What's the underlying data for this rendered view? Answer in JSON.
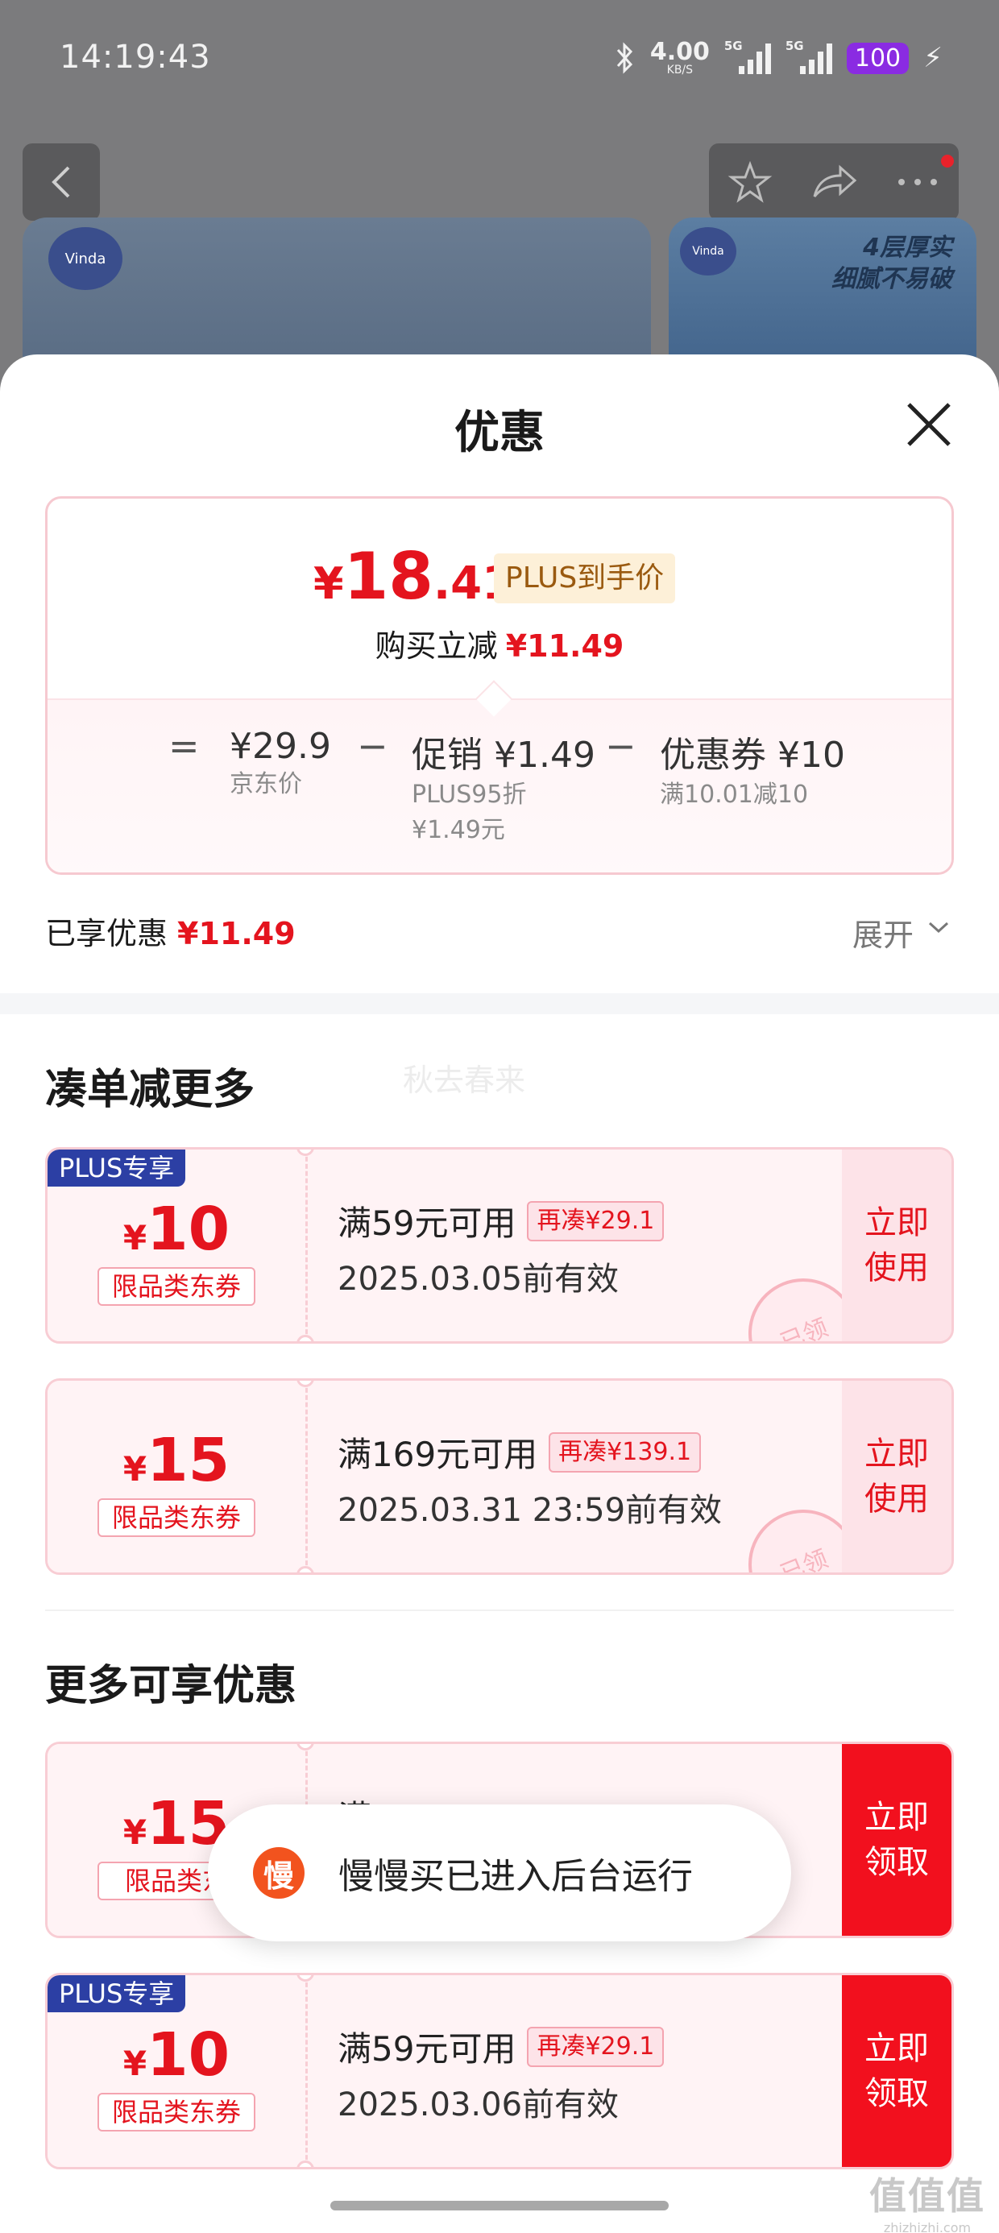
{
  "status_bar": {
    "time": "14:19:43",
    "speed_value": "4.00",
    "speed_unit": "KB/S",
    "sig1_label": "5G",
    "sig2_label": "5G",
    "battery": "100"
  },
  "background_page": {
    "brand_logo_text": "Vinda",
    "slogan_line1": "4层厚实",
    "slogan_line2": "细腻不易破"
  },
  "sheet": {
    "title": "优惠",
    "price": {
      "currency": "¥",
      "integer": "18",
      "decimal": ".41",
      "tag": "PLUS到手价",
      "reduce_label": "购买立减",
      "reduce_value": "¥11.49"
    },
    "breakdown": {
      "equals": "=",
      "jd_price": "¥29.9",
      "jd_price_label": "京东价",
      "minus1": "−",
      "promo": "促销 ¥1.49",
      "promo_detail1": "PLUS95折",
      "promo_detail2": "¥1.49元",
      "minus2": "−",
      "coupon": "优惠券 ¥10",
      "coupon_detail": "满10.01减10"
    },
    "enjoyed_label": "已享优惠",
    "enjoyed_value": "¥11.49",
    "expand_label": "展开"
  },
  "section1": {
    "title": "凑单减更多",
    "watermark": "秋去春来"
  },
  "section2": {
    "title": "更多可享优惠"
  },
  "coupons": [
    {
      "badge": "PLUS专享",
      "currency": "¥",
      "amount": "10",
      "category": "限品类东券",
      "condition": "满59元可用",
      "again": "再凑¥29.1",
      "validity": "2025.03.05前有效",
      "button": "立即\n使用",
      "stamp": "已领"
    },
    {
      "currency": "¥",
      "amount": "15",
      "category": "限品类东券",
      "condition": "满169元可用",
      "again": "再凑¥139.1",
      "validity": "2025.03.31 23:59前有效",
      "button": "立即\n使用",
      "stamp": "已领"
    },
    {
      "currency": "¥",
      "amount": "15",
      "category": "限品类东",
      "condition": "满",
      "button": "立即\n领取"
    },
    {
      "badge": "PLUS专享",
      "currency": "¥",
      "amount": "10",
      "category": "限品类东券",
      "condition": "满59元可用",
      "again": "再凑¥29.1",
      "validity": "2025.03.06前有效",
      "button": "立即\n领取"
    }
  ],
  "toast": {
    "icon_char": "慢",
    "text": "慢慢买已进入后台运行"
  },
  "site_watermark": {
    "logo": "值值值",
    "url": "zhizhizhi.com"
  },
  "colors": {
    "accent_red": "#e4141e",
    "plus_blue": "#2c3fa4",
    "button_red": "#f2101e"
  }
}
